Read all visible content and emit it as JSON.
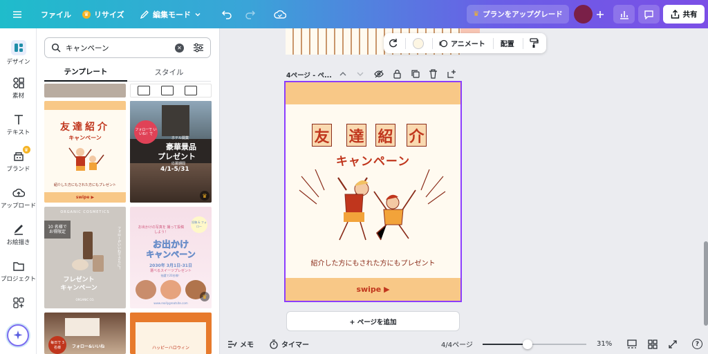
{
  "topbar": {
    "file_label": "ファイル",
    "resize_label": "リサイズ",
    "edit_mode_label": "編集モード",
    "upgrade_label": "プランをアップグレード",
    "share_label": "共有"
  },
  "rail": {
    "items": [
      {
        "label": "デザイン",
        "icon": "design-icon"
      },
      {
        "label": "素材",
        "icon": "elements-icon"
      },
      {
        "label": "テキスト",
        "icon": "text-icon"
      },
      {
        "label": "ブランド",
        "icon": "brand-icon"
      },
      {
        "label": "アップロード",
        "icon": "upload-icon"
      },
      {
        "label": "お絵描き",
        "icon": "draw-icon"
      },
      {
        "label": "プロジェクト",
        "icon": "folder-icon"
      },
      {
        "label": "",
        "icon": "apps-icon"
      }
    ]
  },
  "panel": {
    "search_value": "キャンペーン",
    "tabs": [
      "テンプレート",
      "スタイル"
    ],
    "thumb1": {
      "title": "友達紹介",
      "sub": "キャンペーン",
      "caption": "紹介した方にもされた方にもプレゼント",
      "swipe": "swipe ▶"
    },
    "thumb2": {
      "badge": "フォローで いいね！で",
      "head": "ホテル開業",
      "title": "豪華景品",
      "title2": "プレゼント",
      "date": "4/1-5/31",
      "note": "応募期間"
    },
    "thumb3": {
      "brand": "ORGANIC COSMETICS",
      "badge": "10 名様で お得限定",
      "side": "フォロー&いいねでさらに！",
      "title": "フレゼント",
      "title2": "キャンペーン",
      "footer": "ORGANIC CO."
    },
    "thumb4": {
      "tag": "投稿 & フォロー",
      "lead": "お出かけの写真を 撮って投稿しよう！",
      "title": "お出かけ",
      "title2": "キャンペーン",
      "date": "2030年 3月1日-31日",
      "sub": "選べるスイーツプレゼント",
      "note": "抽選で20名様！",
      "url": "www.reallygreatsite.com"
    },
    "thumb5": {
      "badge": "毎日で 3 名様",
      "text": "フォロー&いいね"
    },
    "thumb6": {
      "text": "ハッピーハロウィン"
    }
  },
  "context_bar": {
    "animate_label": "アニメート",
    "arrange_label": "配置",
    "color": "#fdf6e3"
  },
  "page_header": {
    "label": "4ページ - ペ..."
  },
  "design": {
    "chars": [
      "友",
      "達",
      "紹",
      "介"
    ],
    "subtitle": "キャンペーン",
    "caption": "紹介した方にもされた方にもプレゼント",
    "swipe": "swipe ▶",
    "accent": "#f8c887",
    "text_color": "#c0361d"
  },
  "add_page_label": "+ ページを追加",
  "bottombar": {
    "notes_label": "メモ",
    "timer_label": "タイマー",
    "page_count": "4/4ページ",
    "zoom": "31%",
    "zoom_fraction": 0.31
  },
  "colors": {
    "selection": "#8b3dff",
    "upgrade_bg": "#5b5fe0",
    "avatar": "#7a2048"
  }
}
